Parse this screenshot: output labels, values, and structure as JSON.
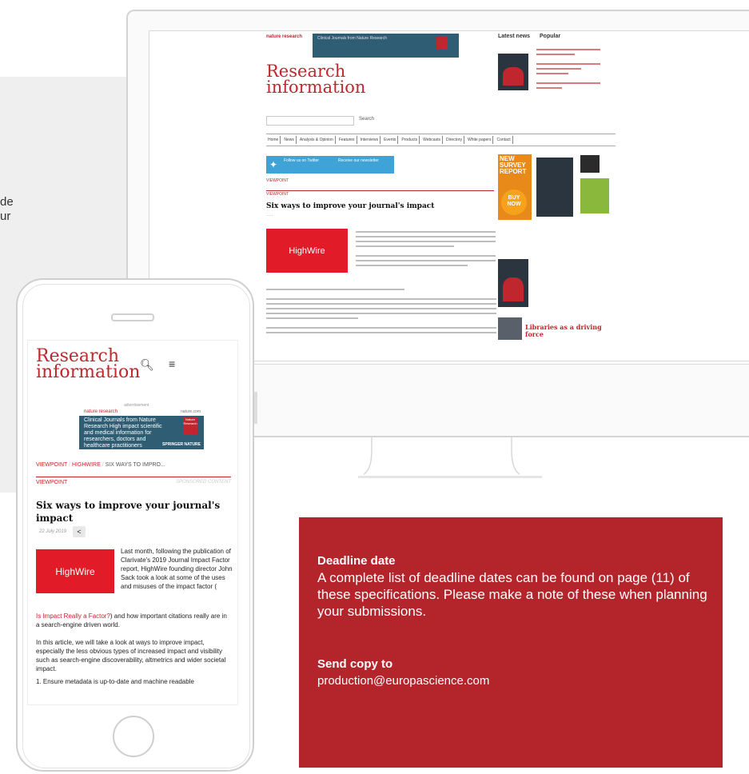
{
  "background_fragment": {
    "line1": "de",
    "line2": "ur"
  },
  "website": {
    "header_ad_label": "nature research",
    "header_ad_text": "Clinical Journals from Nature Research",
    "brand_line1": "Research",
    "brand_line2": "information",
    "search_button": "Search",
    "nav_items": [
      "Home",
      "News",
      "Analysis & Opinion",
      "Features",
      "Interviews",
      "Events",
      "Products",
      "Webcasts",
      "Directory",
      "White papers",
      "Contact"
    ],
    "twitter_text": "Follow us on Twitter",
    "newsletter_text": "Receive our newsletter",
    "section": "VIEWPOINT",
    "article_title": "Six ways to improve your journal's impact",
    "article_logo": "HighWire",
    "latest_news_label": "Latest news",
    "popular_label": "Popular",
    "survey_label": "NEW SURVEY REPORT",
    "buy_now_label": "BUY NOW",
    "libraries_headline": "Libraries as a driving force"
  },
  "phone": {
    "brand_line1": "Research",
    "brand_line2": "information",
    "ad_label": "advertisement",
    "ad_brand": "nature research",
    "ad_brand_right": "nature.com",
    "ad_text": "Clinical Journals from Nature Research High impact scientific and medical information for researchers, doctors and healthcare practitioners",
    "ad_badge": "Nature Research",
    "ad_publisher": "SPRINGER NATURE",
    "breadcrumb_1": "VIEWPOINT",
    "breadcrumb_2": "HIGHWIRE",
    "breadcrumb_3": "SIX WAYS TO IMPRO...",
    "section": "VIEWPOINT",
    "sponsored": "SPONSORED CONTENT",
    "title": "Six ways to improve your journal's impact",
    "date": "22 July 2019",
    "share_icon": "share-icon",
    "logo_text": "HighWire",
    "para1": "Last month, following the publication of Clarivate's 2019 Journal Impact Factor report, HighWire founding director John Sack took a look at some of the uses and misuses of the impact factor (",
    "para1_link": "Is Impact Really a Factor?",
    "para1_end": ") and how important citations really are in a search-engine driven world.",
    "para2": "In this article, we will take a look at ways to improve impact, especially the less obvious types of increased impact and visibility such as search-engine discoverability, altmetrics and wider societal impact.",
    "para3": "1. Ensure metadata is up-to-date and machine readable"
  },
  "info_box": {
    "heading1": "Deadline date",
    "body1": "A complete list of deadline dates can be found on page (11) of these specifications. Please make a note of these when planning your submissions.",
    "heading2": "Send copy to",
    "body2": "production@europascience.com"
  },
  "colors": {
    "brand_red": "#b3242b",
    "twitter_blue": "#3fa3d8",
    "highwire_red": "#e11b27"
  }
}
